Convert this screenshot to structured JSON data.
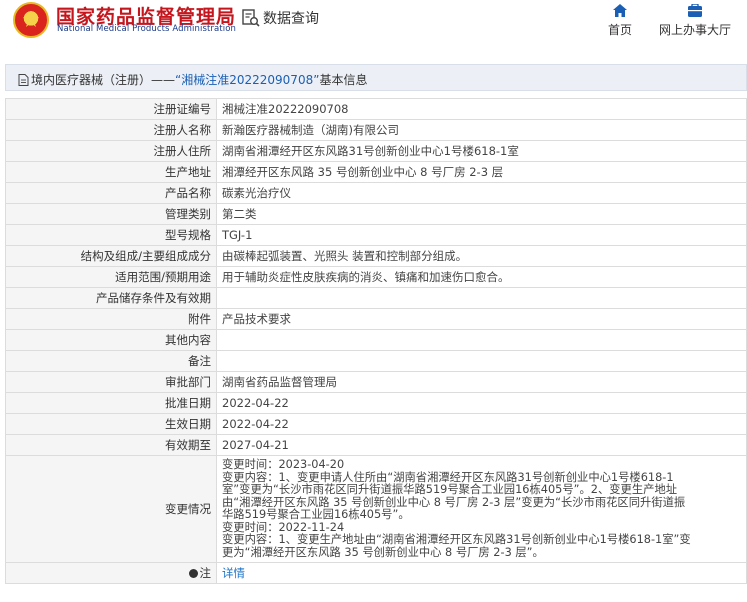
{
  "header": {
    "logo_cn": "国家药品监督管理局",
    "logo_en": "National Medical Products Administration",
    "data_query_label": "数据查询",
    "nav": [
      {
        "label": "首页",
        "icon": "home-icon"
      },
      {
        "label": "网上办事大厅",
        "icon": "office-hall-icon"
      }
    ]
  },
  "breadcrumb": {
    "category": "境内医疗器械（注册）",
    "separator": "——",
    "record": "“湘械注准20222090708”",
    "suffix": "基本信息"
  },
  "rows": [
    {
      "label": "注册证编号",
      "value": "湘械注准20222090708"
    },
    {
      "label": "注册人名称",
      "value": "新瀚医疗器械制造（湖南)有限公司"
    },
    {
      "label": "注册人住所",
      "value": "湖南省湘潭经开区东风路31号创新创业中心1号楼618-1室"
    },
    {
      "label": "生产地址",
      "value": "湘潭经开区东风路 35 号创新创业中心 8 号厂房 2-3 层"
    },
    {
      "label": "产品名称",
      "value": "碳素光治疗仪"
    },
    {
      "label": "管理类别",
      "value": "第二类"
    },
    {
      "label": "型号规格",
      "value": "TGJ-1"
    },
    {
      "label": "结构及组成/主要组成成分",
      "value": "由碳棒起弧装置、光照头 装置和控制部分组成。"
    },
    {
      "label": "适用范围/预期用途",
      "value": "用于辅助炎症性皮肤疾病的消炎、镇痛和加速伤口愈合。"
    },
    {
      "label": "产品储存条件及有效期",
      "value": ""
    },
    {
      "label": "附件",
      "value": "产品技术要求"
    },
    {
      "label": "其他内容",
      "value": ""
    },
    {
      "label": "备注",
      "value": ""
    },
    {
      "label": "审批部门",
      "value": "湖南省药品监督管理局"
    },
    {
      "label": "批准日期",
      "value": "2022-04-22"
    },
    {
      "label": "生效日期",
      "value": "2022-04-22"
    },
    {
      "label": "有效期至",
      "value": "2027-04-21"
    }
  ],
  "changes": {
    "label": "变更情况",
    "lines": [
      "变更时间：2023-04-20",
      "变更内容：1、变更申请人住所由“湖南省湘潭经开区东风路31号创新创业中心1号楼618-1",
      "室”变更为“长沙市雨花区同升街道振华路519号聚合工业园16栋405号”。2、变更生产地址",
      "由“湘潭经开区东风路 35 号创新创业中心 8 号厂房 2-3 层”变更为“长沙市雨花区同升街道振",
      "华路519号聚合工业园16栋405号”。",
      "变更时间：2022-11-24",
      "变更内容：1、变更生产地址由“湖南省湘潭经开区东风路31号创新创业中心1号楼618-1室”变",
      "更为“湘潭经开区东风路 35 号创新创业中心 8 号厂房 2-3 层”。"
    ]
  },
  "note": {
    "label": "注",
    "link": "详情"
  }
}
